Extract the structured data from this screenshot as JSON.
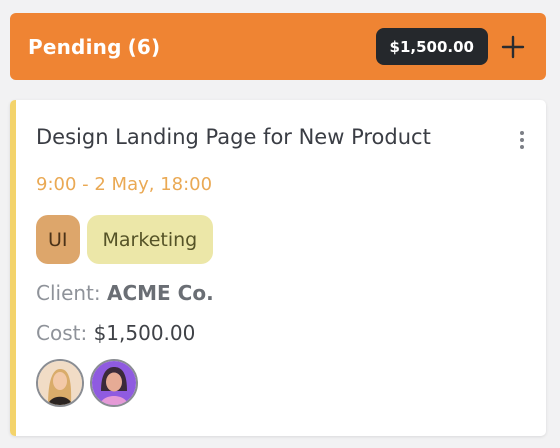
{
  "column": {
    "title": "Pending",
    "count": "(6)",
    "total": "$1,500.00",
    "color": "#ef8433"
  },
  "card": {
    "title": "Design Landing Page for New Product",
    "time": "9:00 - 2 May, 18:00",
    "accent_color": "#f3d36b",
    "tags": [
      {
        "label": "UI",
        "color": "#dda66b"
      },
      {
        "label": "Marketing",
        "color": "#ece7a8"
      }
    ],
    "client_label": "Client:",
    "client_value": "ACME Co.",
    "cost_label": "Cost:",
    "cost_value": "$1,500.00",
    "assignees": [
      {
        "icon": "avatar-woman-blonde"
      },
      {
        "icon": "avatar-woman-purple"
      }
    ]
  },
  "icons": {
    "add": "plus-icon",
    "menu": "kebab-menu-icon"
  }
}
